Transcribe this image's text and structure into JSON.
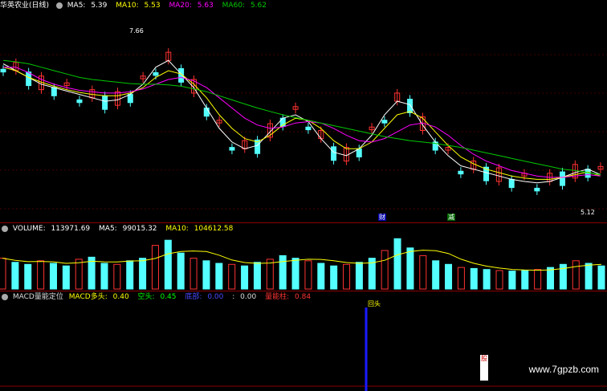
{
  "price_pane": {
    "stock_name": "华英农业(日线)",
    "ma5_label": "MA5:",
    "ma5_value": "5.39",
    "ma10_label": "MA10:",
    "ma10_value": "5.53",
    "ma20_label": "MA20:",
    "ma20_value": "5.63",
    "ma60_label": "MA60:",
    "ma60_value": "5.62",
    "high_label": "7.66",
    "low_label": "5.12",
    "event_tag_1": "财",
    "event_tag_2": "减"
  },
  "volume_pane": {
    "title": "VOLUME:",
    "volume_value": "113971.69",
    "ma5_label": "MA5:",
    "ma5_value": "99015.32",
    "ma10_label": "MA10:",
    "ma10_value": "104612.58"
  },
  "macd_pane": {
    "title": "MACD量能定位",
    "long_label": "MACD多头:",
    "long_value": "0.40",
    "short_label": "空头:",
    "short_value": "0.45",
    "third_label": "底部:",
    "third_value": "0.00",
    "fourth_label": ":",
    "fourth_value": "0.00",
    "fifth_label": "量能柱:",
    "fifth_value": "0.84",
    "signal_label": "回头"
  },
  "watermark": "www.7gpzb.com",
  "colors": {
    "up": "#ff3232",
    "down": "#54ffff",
    "ma5": "#ffffff",
    "ma10": "#ffff00",
    "ma20": "#ff00ff",
    "ma60": "#00c800",
    "grid": "#8b0000",
    "signal": "#1a1aff"
  },
  "chart_data": {
    "type": "line",
    "title": "华英农业(日线)",
    "ylim": [
      5.0,
      8.0
    ],
    "series": [
      {
        "name": "MA5",
        "values": [
          7.25,
          7.15,
          7.05,
          6.95,
          6.9,
          6.85,
          6.8,
          6.75,
          6.7,
          6.72,
          6.8,
          6.95,
          7.2,
          7.3,
          7.1,
          6.9,
          6.6,
          6.3,
          6.1,
          6.0,
          6.05,
          6.25,
          6.45,
          6.5,
          6.4,
          6.15,
          5.95,
          5.9,
          6.0,
          6.2,
          6.5,
          6.7,
          6.65,
          6.35,
          6.1,
          5.9,
          5.75,
          5.7,
          5.65,
          5.6,
          5.55,
          5.52,
          5.5,
          5.52,
          5.58,
          5.65,
          5.7,
          5.62
        ]
      },
      {
        "name": "MA10",
        "values": [
          7.2,
          7.15,
          7.05,
          6.98,
          6.92,
          6.87,
          6.83,
          6.8,
          6.78,
          6.78,
          6.82,
          6.9,
          7.05,
          7.15,
          7.1,
          6.95,
          6.75,
          6.5,
          6.3,
          6.15,
          6.1,
          6.2,
          6.35,
          6.45,
          6.42,
          6.3,
          6.12,
          6.0,
          6.0,
          6.1,
          6.3,
          6.5,
          6.55,
          6.45,
          6.25,
          6.05,
          5.88,
          5.78,
          5.7,
          5.65,
          5.6,
          5.57,
          5.55,
          5.55,
          5.58,
          5.62,
          5.66,
          5.6
        ]
      },
      {
        "name": "MA20",
        "values": [
          7.2,
          7.2,
          7.12,
          7.02,
          6.95,
          6.9,
          6.86,
          6.84,
          6.82,
          6.82,
          6.84,
          6.88,
          6.95,
          7.02,
          7.05,
          7.0,
          6.9,
          6.75,
          6.6,
          6.45,
          6.35,
          6.3,
          6.32,
          6.38,
          6.4,
          6.38,
          6.3,
          6.2,
          6.12,
          6.1,
          6.15,
          6.25,
          6.35,
          6.38,
          6.32,
          6.2,
          6.05,
          5.92,
          5.82,
          5.75,
          5.68,
          5.64,
          5.6,
          5.58,
          5.58,
          5.6,
          5.62,
          5.6
        ]
      },
      {
        "name": "MA60",
        "values": [
          7.3,
          7.28,
          7.25,
          7.2,
          7.15,
          7.1,
          7.05,
          7.02,
          7.0,
          6.98,
          6.96,
          6.95,
          6.95,
          6.94,
          6.92,
          6.88,
          6.84,
          6.78,
          6.72,
          6.66,
          6.6,
          6.55,
          6.5,
          6.46,
          6.42,
          6.38,
          6.34,
          6.3,
          6.26,
          6.22,
          6.18,
          6.15,
          6.12,
          6.1,
          6.08,
          6.05,
          6.02,
          5.98,
          5.94,
          5.9,
          5.86,
          5.82,
          5.78,
          5.74,
          5.7,
          5.68,
          5.65,
          5.62
        ]
      }
    ],
    "volume": [
      60,
      52,
      48,
      55,
      50,
      45,
      58,
      62,
      50,
      48,
      55,
      60,
      85,
      95,
      70,
      60,
      55,
      50,
      48,
      45,
      52,
      58,
      65,
      60,
      55,
      50,
      45,
      48,
      52,
      60,
      75,
      98,
      80,
      65,
      55,
      48,
      42,
      40,
      38,
      36,
      35,
      36,
      38,
      42,
      48,
      55,
      50,
      45
    ]
  }
}
